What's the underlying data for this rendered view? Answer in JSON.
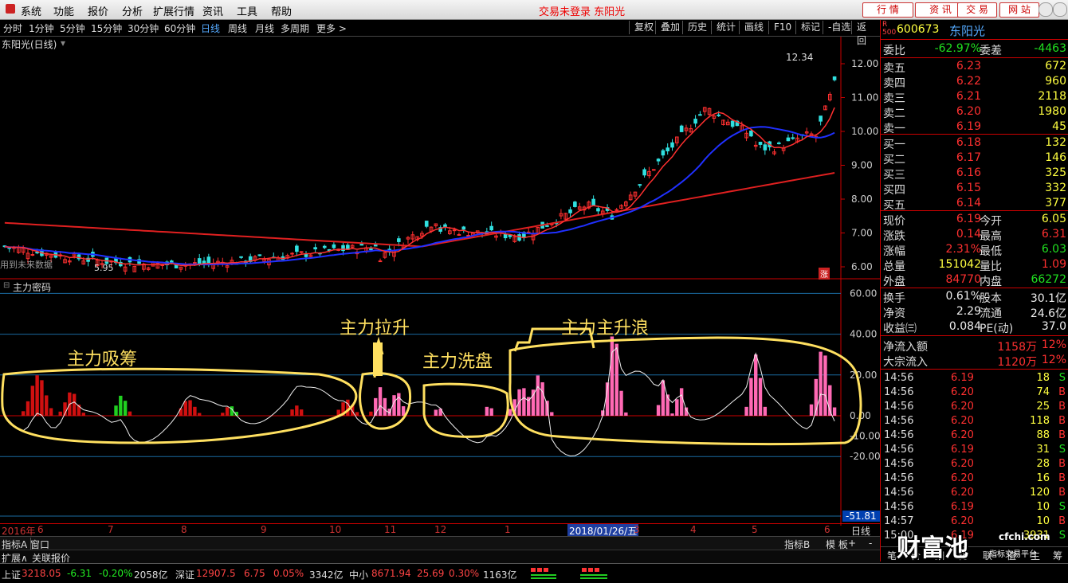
{
  "menu": {
    "items": [
      "系统",
      "功能",
      "报价",
      "分析",
      "扩展行情",
      "资讯",
      "工具",
      "帮助"
    ],
    "center_text": "交易未登录  东阳光",
    "buttons": [
      "行 情",
      "资 讯",
      "交 易",
      "网 站"
    ]
  },
  "toolbar": {
    "periods": [
      "分时",
      "1分钟",
      "5分钟",
      "15分钟",
      "30分钟",
      "60分钟",
      "日线",
      "周线",
      "月线",
      "多周期",
      "更多 >"
    ],
    "active_period": "日线",
    "right_buttons": [
      "复权",
      "叠加",
      "历史",
      "统计",
      "画线",
      "F10",
      "标记",
      "-自选",
      "返回"
    ]
  },
  "main_chart": {
    "title": "东阳光(日线)",
    "high_label": "12.34",
    "low_label": "5.95",
    "future_note": "用到未来数据",
    "y_ticks": [
      "12.00",
      "11.00",
      "10.00",
      "9.00",
      "8.00",
      "7.00",
      "6.00"
    ],
    "y_values": [
      12,
      11,
      10,
      9,
      8,
      7,
      6
    ],
    "rise_marker": "涨"
  },
  "indicator": {
    "title": "主力密码",
    "y_ticks": [
      "60.00",
      "40.00",
      "20.00",
      "0.00",
      "-10.00",
      "-20.00"
    ],
    "y_values": [
      60,
      40,
      20,
      0,
      -10,
      -20
    ],
    "current_value": "-51.81",
    "annotations": [
      "主力吸筹",
      "主力拉升",
      "主力洗盘",
      "主力主升浪"
    ]
  },
  "x_axis": {
    "labels": [
      "2016年",
      "6",
      "7",
      "8",
      "9",
      "10",
      "11",
      "12",
      "1",
      "2018/01/26/五",
      "3",
      "4",
      "5",
      "6"
    ],
    "right_label": "日线"
  },
  "bottom_tabs": {
    "left": [
      "指标A",
      "窗口"
    ],
    "left2": [
      "扩展∧",
      "关联报价"
    ],
    "right": [
      "指标B",
      "模 板",
      "+",
      "-"
    ]
  },
  "quote": {
    "code": "600673",
    "name": "东阳光",
    "badge": "R 500",
    "weibi": {
      "label": "委比",
      "value": "-62.97%",
      "label2": "委差",
      "value2": "-4463"
    },
    "sells": [
      {
        "label": "卖五",
        "price": "6.23",
        "vol": "672"
      },
      {
        "label": "卖四",
        "price": "6.22",
        "vol": "960"
      },
      {
        "label": "卖三",
        "price": "6.21",
        "vol": "2118"
      },
      {
        "label": "卖二",
        "price": "6.20",
        "vol": "1980"
      },
      {
        "label": "卖一",
        "price": "6.19",
        "vol": "45"
      }
    ],
    "buys": [
      {
        "label": "买一",
        "price": "6.18",
        "vol": "132"
      },
      {
        "label": "买二",
        "price": "6.17",
        "vol": "146"
      },
      {
        "label": "买三",
        "price": "6.16",
        "vol": "325"
      },
      {
        "label": "买四",
        "price": "6.15",
        "vol": "332"
      },
      {
        "label": "买五",
        "price": "6.14",
        "vol": "377"
      }
    ],
    "stats": [
      {
        "l1": "现价",
        "v1": "6.19",
        "l2": "今开",
        "v2": "6.05"
      },
      {
        "l1": "涨跌",
        "v1": "0.14",
        "l2": "最高",
        "v2": "6.31"
      },
      {
        "l1": "涨幅",
        "v1": "2.31%",
        "l2": "最低",
        "v2": "6.03"
      },
      {
        "l1": "总量",
        "v1": "151042",
        "l2": "量比",
        "v2": "1.09"
      },
      {
        "l1": "外盘",
        "v1": "84770",
        "l2": "内盘",
        "v2": "66272"
      }
    ],
    "stats2": [
      {
        "l1": "换手",
        "v1": "0.61%",
        "l2": "股本",
        "v2": "30.1亿"
      },
      {
        "l1": "净资",
        "v1": "2.29",
        "l2": "流通",
        "v2": "24.6亿"
      },
      {
        "l1": "收益㈢",
        "v1": "0.084",
        "l2": "PE(动)",
        "v2": "37.0"
      }
    ],
    "flows": [
      {
        "label": "净流入额",
        "value": "1158万",
        "pct": "12%"
      },
      {
        "label": "大宗流入",
        "value": "1120万",
        "pct": "12%"
      }
    ],
    "ticks": [
      {
        "t": "14:56",
        "p": "6.19",
        "v": "18",
        "s": "S"
      },
      {
        "t": "14:56",
        "p": "6.20",
        "v": "74",
        "s": "B"
      },
      {
        "t": "14:56",
        "p": "6.20",
        "v": "25",
        "s": "B"
      },
      {
        "t": "14:56",
        "p": "6.20",
        "v": "118",
        "s": "B"
      },
      {
        "t": "14:56",
        "p": "6.20",
        "v": "88",
        "s": "B"
      },
      {
        "t": "14:56",
        "p": "6.19",
        "v": "31",
        "s": "S"
      },
      {
        "t": "14:56",
        "p": "6.20",
        "v": "28",
        "s": "B"
      },
      {
        "t": "14:56",
        "p": "6.20",
        "v": "16",
        "s": "B"
      },
      {
        "t": "14:56",
        "p": "6.20",
        "v": "120",
        "s": "B"
      },
      {
        "t": "14:56",
        "p": "6.19",
        "v": "10",
        "s": "S"
      },
      {
        "t": "14:57",
        "p": "6.20",
        "v": "10",
        "s": "B"
      },
      {
        "t": "15:00",
        "p": "6.19",
        "v": "3931",
        "s": "S"
      }
    ],
    "bottom_tabs": [
      "笔",
      "价",
      "细",
      "势",
      "联",
      "值",
      "主",
      "筹"
    ],
    "watermark": "财富池",
    "watermark_site": "cfchi.com",
    "watermark_sub": "指标交易平台"
  },
  "status": {
    "sh": {
      "label": "上证",
      "v": "3218.05",
      "chg": "-6.31",
      "pct": "-0.20%",
      "amt": "2058亿"
    },
    "sz": {
      "label": "深证",
      "v": "12907.5",
      "chg": "6.75",
      "pct": "0.05%",
      "amt": "3342亿"
    },
    "zx": {
      "label": "中小",
      "v": "8671.94",
      "chg": "25.69",
      "pct": "0.30%",
      "amt": "1163亿"
    }
  },
  "colors": {
    "up": "#ff3030",
    "down": "#20e020",
    "ma5": "#ff3030",
    "ma20": "#2030ff",
    "ma60": "#e02020",
    "annot": "#ffe060"
  }
}
